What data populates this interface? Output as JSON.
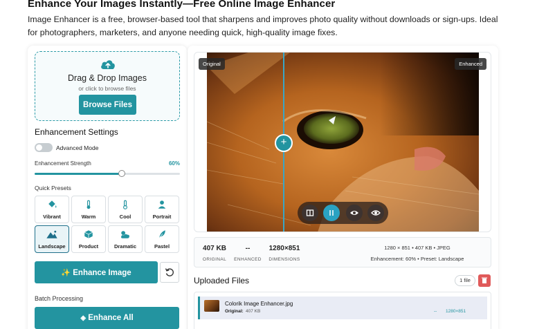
{
  "header": {
    "title": "Enhance Your Images Instantly—Free Online Image Enhancer",
    "description": "Image Enhancer is a free, browser-based tool that sharpens and improves photo quality without downloads or sign-ups. Ideal for photographers, marketers, and anyone needing quick, high-quality image fixes."
  },
  "upload": {
    "icon": "cloud-upload-icon",
    "title": "Drag & Drop Images",
    "subtitle": "or click to browse files",
    "browse_label": "Browse Files"
  },
  "settings": {
    "title": "Enhancement Settings",
    "advanced_mode_label": "Advanced Mode",
    "advanced_mode_on": false,
    "strength_label": "Enhancement Strength",
    "strength_value": "60%",
    "strength_fraction": 0.6
  },
  "presets": {
    "label": "Quick Presets",
    "items": [
      {
        "label": "Vibrant",
        "icon": "paint-bucket-icon"
      },
      {
        "label": "Warm",
        "icon": "thermometer-icon"
      },
      {
        "label": "Cool",
        "icon": "thermometer-icon"
      },
      {
        "label": "Portrait",
        "icon": "person-icon"
      },
      {
        "label": "Landscape",
        "icon": "mountain-icon",
        "active": true
      },
      {
        "label": "Product",
        "icon": "cube-icon"
      },
      {
        "label": "Dramatic",
        "icon": "cloud-sun-icon"
      },
      {
        "label": "Pastel",
        "icon": "feather-icon"
      }
    ]
  },
  "actions": {
    "enhance_label": "Enhance Image",
    "batch_label": "Batch Processing",
    "enhance_all_label": "Enhance All"
  },
  "preview": {
    "original_badge": "Original",
    "enhanced_badge": "Enhanced",
    "compare_position": 0.28
  },
  "stats": {
    "original_value": "407 KB",
    "original_label": "ORIGINAL",
    "enhanced_value": "--",
    "enhanced_label": "ENHANCED",
    "dimensions_value": "1280×851",
    "dimensions_label": "DIMENSIONS",
    "meta_line1": "1280 × 851 • 407 KB • JPEG",
    "meta_line2": "Enhancement: 60% • Preset: Landscape"
  },
  "uploaded": {
    "title": "Uploaded Files",
    "count_label": "1 file",
    "files": [
      {
        "name": "Colorik Image Enhancer.jpg",
        "original_label": "Original:",
        "original_size": "407 KB",
        "enhanced": "--",
        "dimensions": "1280×851"
      }
    ]
  },
  "colors": {
    "accent": "#2394a0",
    "danger": "#e05a5a",
    "divider": "#39a6c6"
  }
}
